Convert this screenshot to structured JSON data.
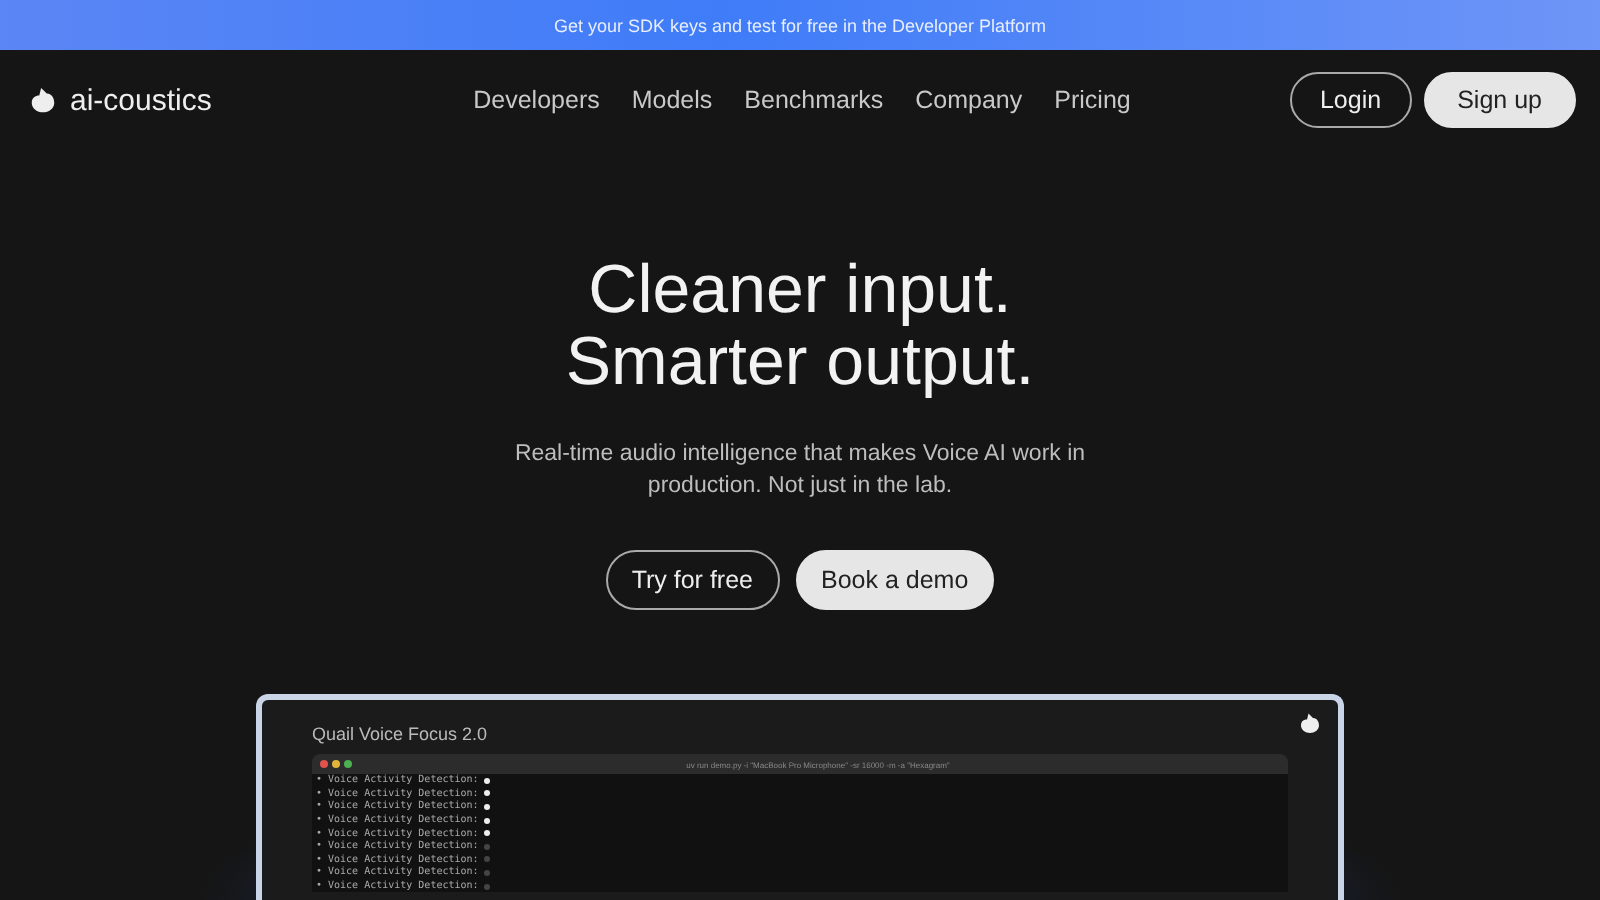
{
  "banner": {
    "text": "Get your SDK keys and test for free in the Developer Platform"
  },
  "nav": {
    "brand": "ai-coustics",
    "links": [
      "Developers",
      "Models",
      "Benchmarks",
      "Company",
      "Pricing"
    ],
    "login": "Login",
    "signup": "Sign up"
  },
  "hero": {
    "title_lines": [
      "Cleaner input.",
      "Smarter output."
    ],
    "subtitle": "Real-time audio intelligence that makes Voice AI work in production. Not just in the lab.",
    "primary": "Try for free",
    "secondary": "Book a demo"
  },
  "demo": {
    "title": "Quail Voice Focus 2.0",
    "terminal_title": "uv run demo.py -i \"MacBook Pro Microphone\" -sr 16000 -m -a \"Hexagram\"",
    "lines": [
      {
        "text": "• Voice Activity Detection:",
        "on": true
      },
      {
        "text": "• Voice Activity Detection:",
        "on": true
      },
      {
        "text": "• Voice Activity Detection:",
        "on": true
      },
      {
        "text": "• Voice Activity Detection:",
        "on": true
      },
      {
        "text": "• Voice Activity Detection:",
        "on": true
      },
      {
        "text": "• Voice Activity Detection:",
        "on": false
      },
      {
        "text": "• Voice Activity Detection:",
        "on": false
      },
      {
        "text": "• Voice Activity Detection:",
        "on": false
      },
      {
        "text": "• Voice Activity Detection:",
        "on": false
      }
    ]
  }
}
